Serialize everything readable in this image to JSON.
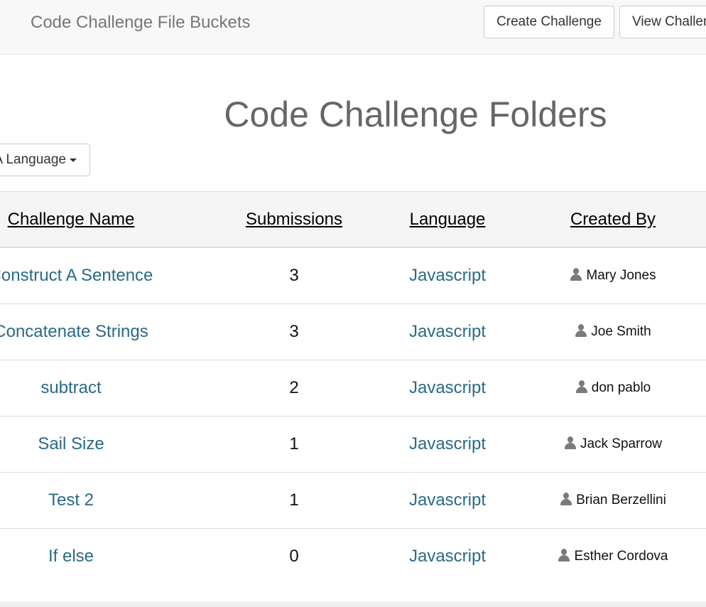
{
  "navbar": {
    "brand": "Code Challenge File Buckets",
    "create_label": "Create Challenge",
    "view_label": "View Challenges"
  },
  "page": {
    "title": "Code Challenge Folders"
  },
  "filter": {
    "language_label": "A Language"
  },
  "table": {
    "headers": {
      "name": "Challenge Name",
      "submissions": "Submissions",
      "language": "Language",
      "created_by": "Created By"
    },
    "rows": [
      {
        "name": "Construct A Sentence",
        "submissions": "3",
        "language": "Javascript",
        "created_by": "Mary Jones"
      },
      {
        "name": "Concatenate Strings",
        "submissions": "3",
        "language": "Javascript",
        "created_by": "Joe Smith"
      },
      {
        "name": "subtract",
        "submissions": "2",
        "language": "Javascript",
        "created_by": "don pablo"
      },
      {
        "name": "Sail Size",
        "submissions": "1",
        "language": "Javascript",
        "created_by": "Jack Sparrow"
      },
      {
        "name": "Test 2",
        "submissions": "1",
        "language": "Javascript",
        "created_by": "Brian Berzellini"
      },
      {
        "name": "If else",
        "submissions": "0",
        "language": "Javascript",
        "created_by": "Esther Cordova"
      }
    ]
  },
  "icons": {
    "creator": "user-icon",
    "dropdown": "caret-down-icon"
  },
  "colors": {
    "link": "#2a6a88",
    "header_bg": "#f5f5f5",
    "navbar_bg": "#f8f8f8"
  }
}
